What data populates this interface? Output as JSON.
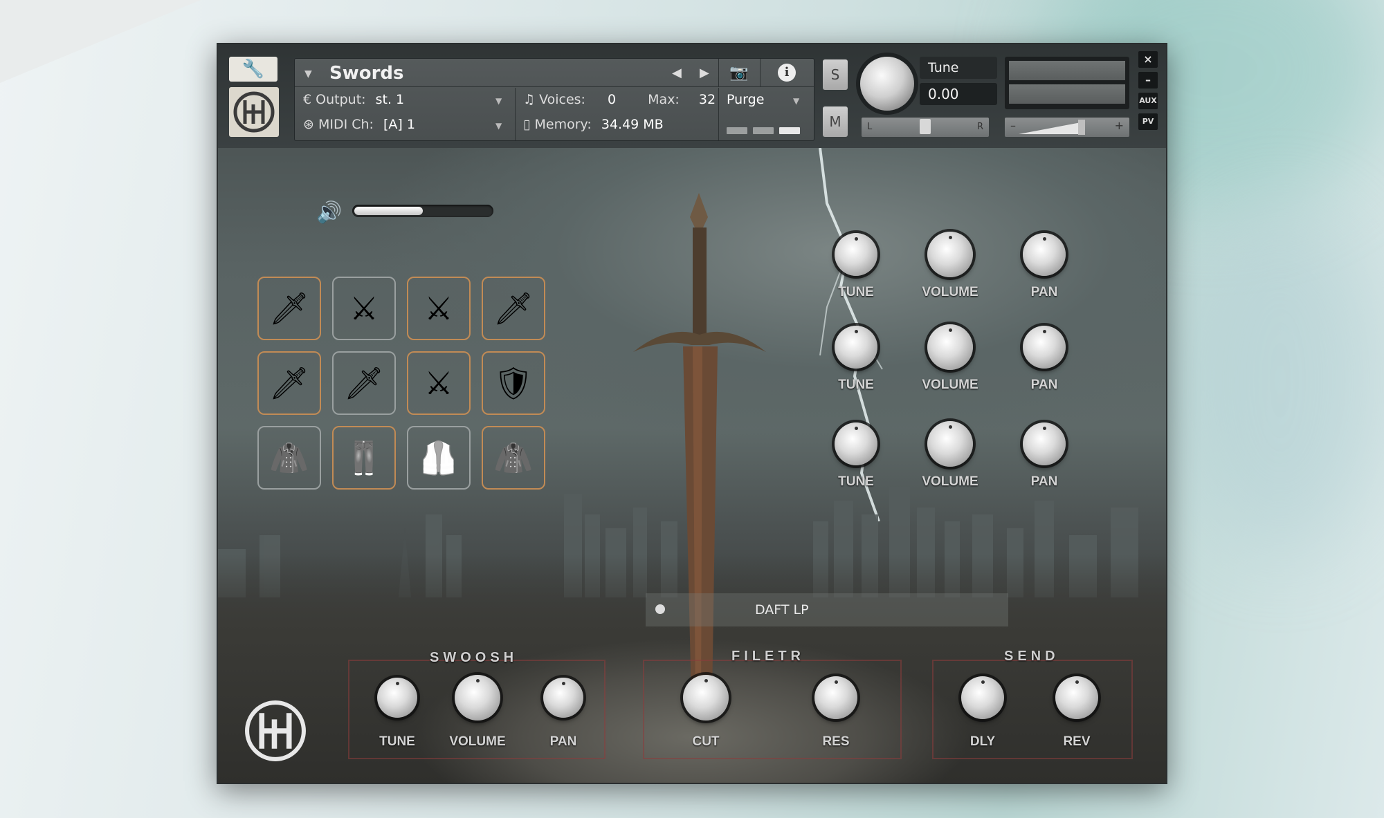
{
  "header": {
    "instrument_name": "Swords",
    "output_label": "Output:",
    "output_value": "st. 1",
    "midi_label": "MIDI Ch:",
    "midi_value": "[A]  1",
    "voices_label": "Voices:",
    "voices_value": "0",
    "max_label": "Max:",
    "max_value": "32",
    "memory_label": "Memory:",
    "memory_value": "34.49 MB",
    "purge_label": "Purge",
    "solo_label": "S",
    "mute_label": "M",
    "tune_label": "Tune",
    "tune_value": "0.00",
    "pan_left": "L",
    "pan_right": "R",
    "vol_minus": "–",
    "vol_plus": "+",
    "aux_label": "AUX",
    "pv_label": "PV",
    "close_label": "×",
    "min_label": "–"
  },
  "master_volume": {
    "level": 0.5
  },
  "sound_tiles": [
    {
      "icon": "sword-icon",
      "style": "orange"
    },
    {
      "icon": "katana-icon",
      "style": "gray"
    },
    {
      "icon": "crossed-swords-icon",
      "style": "orange"
    },
    {
      "icon": "blade-icon",
      "style": "orange"
    },
    {
      "icon": "dagger-icon",
      "style": "orange"
    },
    {
      "icon": "rapier-icon",
      "style": "gray"
    },
    {
      "icon": "sheathed-sword-icon",
      "style": "orange"
    },
    {
      "icon": "shield-icon",
      "style": "orange"
    },
    {
      "icon": "jacket-icon",
      "style": "gray"
    },
    {
      "icon": "pants-icon",
      "style": "orange"
    },
    {
      "icon": "vest-icon",
      "style": "gray"
    },
    {
      "icon": "hoodie-icon",
      "style": "orange"
    }
  ],
  "layer_knobs": [
    {
      "tune": "TUNE",
      "volume": "VOLUME",
      "pan": "PAN"
    },
    {
      "tune": "TUNE",
      "volume": "VOLUME",
      "pan": "PAN"
    },
    {
      "tune": "TUNE",
      "volume": "VOLUME",
      "pan": "PAN"
    }
  ],
  "filter_mode": "DAFT LP",
  "sections": {
    "swoosh": {
      "title": "SWOOSH",
      "tune": "TUNE",
      "volume": "VOLUME",
      "pan": "PAN"
    },
    "filter": {
      "title": "FILETR",
      "cut": "CUT",
      "res": "RES"
    },
    "send": {
      "title": "SEND",
      "dly": "DLY",
      "rev": "REV"
    }
  },
  "colors": {
    "accent_orange": "#c28b55",
    "tile_gray": "#9aa0a0",
    "section_border": "#8c3c3c"
  }
}
